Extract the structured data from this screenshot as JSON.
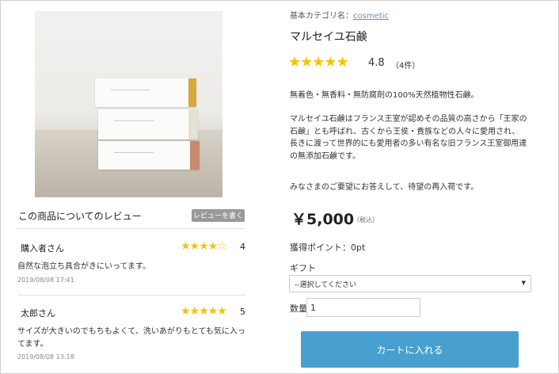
{
  "product": {
    "category_label": "基本カテゴリ名：",
    "category_link": "cosmetic",
    "name": "マルセイユ石鹸",
    "rating_stars": "★★★★★",
    "rating": "4.8",
    "rating_count": "（4件）",
    "description": [
      "無着色・無香料・無防腐剤の100%天然植物性石鹸。",
      "マルセイユ石鹸はフランス王室が認めその品質の高さから「王家の石鹸」とも呼ばれ、古くから王侯・貴族などの人々に愛用され、長きに渡って世界的にも愛用者の多い有名な旧フランス王室御用達の無添加石鹸です。",
      "みなさまのご要望にお答えして、待望の再入荷です。"
    ],
    "price": "￥5,000",
    "tax_note": "（税込）",
    "points": "獲得ポイント：0pt",
    "gift_label": "ギフト",
    "gift_select_value": "--選択してください",
    "quantity_label": "数量",
    "quantity_value": "1",
    "cart_button": "カートに入れる"
  },
  "reviews_section": {
    "title": "この商品についてのレビュー",
    "write_button": "レビューを書く",
    "reviews": [
      {
        "name": "購入者さん",
        "stars": "★★★★☆",
        "score": "4",
        "comment": "自然な泡立ち具合がきにいってます。",
        "date": "2019/08/08 17:41"
      },
      {
        "name": "太郎さん",
        "stars": "★★★★★",
        "score": "5",
        "comment": "サイズが大きいのでもちもよくて、洗いあがりもとても気に入ってます。",
        "date": "2019/08/08 13:18"
      }
    ]
  },
  "colors": {
    "star": "#f4c20d",
    "cart_button": "#48a0d0",
    "review_button": "#999999",
    "category_link": "#6f8db5"
  },
  "icons": {
    "select_arrow": "chevron-down-icon",
    "star": "star-icon"
  }
}
